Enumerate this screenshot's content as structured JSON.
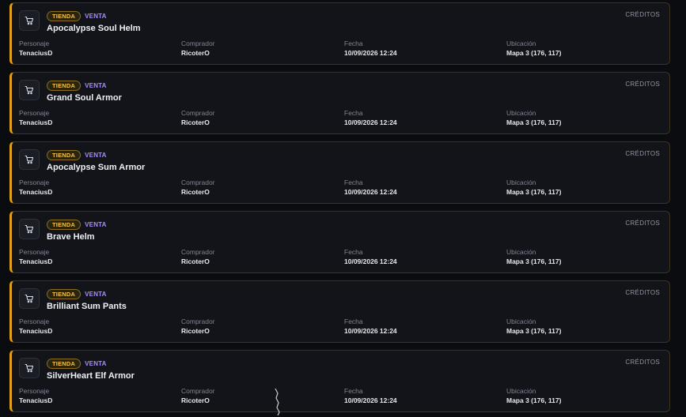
{
  "labels": {
    "personaje": "Personaje",
    "comprador": "Comprador",
    "fecha": "Fecha",
    "ubicacion": "Ubicación"
  },
  "colors": {
    "accent": "#e0a01a",
    "badge_tienda": "#f5c542",
    "badge_venta": "#a78bfa"
  },
  "items": [
    {
      "badge": "TIENDA",
      "type": "VENTA",
      "name": "Apocalypse Soul Helm",
      "currency": "CRÉDITOS",
      "personaje": "TenaciusD",
      "comprador": "RicoterO",
      "fecha": "10/09/2026 12:24",
      "ubicacion": "Mapa 3 (176, 117)",
      "icon": "cart-icon"
    },
    {
      "badge": "TIENDA",
      "type": "VENTA",
      "name": "Grand Soul Armor",
      "currency": "CRÉDITOS",
      "personaje": "TenaciusD",
      "comprador": "RicoterO",
      "fecha": "10/09/2026 12:24",
      "ubicacion": "Mapa 3 (176, 117)",
      "icon": "cart-icon"
    },
    {
      "badge": "TIENDA",
      "type": "VENTA",
      "name": "Apocalypse Sum Armor",
      "currency": "CRÉDITOS",
      "personaje": "TenaciusD",
      "comprador": "RicoterO",
      "fecha": "10/09/2026 12:24",
      "ubicacion": "Mapa 3 (176, 117)",
      "icon": "cart-icon"
    },
    {
      "badge": "TIENDA",
      "type": "VENTA",
      "name": "Brave Helm",
      "currency": "CRÉDITOS",
      "personaje": "TenaciusD",
      "comprador": "RicoterO",
      "fecha": "10/09/2026 12:24",
      "ubicacion": "Mapa 3 (176, 117)",
      "icon": "cart-icon"
    },
    {
      "badge": "TIENDA",
      "type": "VENTA",
      "name": "Brilliant Sum Pants",
      "currency": "CRÉDITOS",
      "personaje": "TenaciusD",
      "comprador": "RicoterO",
      "fecha": "10/09/2026 12:24",
      "ubicacion": "Mapa 3 (176, 117)",
      "icon": "cart-icon"
    },
    {
      "badge": "TIENDA",
      "type": "VENTA",
      "name": "SilverHeart Elf Armor",
      "currency": "CRÉDITOS",
      "personaje": "TenaciusD",
      "comprador": "RicoterO",
      "fecha": "10/09/2026 12:24",
      "ubicacion": "Mapa 3 (176, 117)",
      "icon": "cart-icon"
    }
  ]
}
